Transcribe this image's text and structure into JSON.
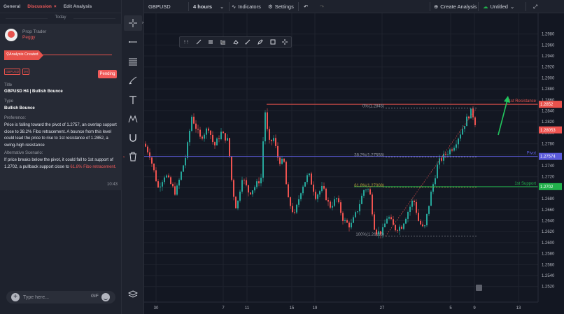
{
  "panel": {
    "tabs": [
      {
        "label": "General"
      },
      {
        "label": "Discussion",
        "close": "×"
      },
      {
        "label": "Edit Analysis"
      }
    ],
    "day_divider": "Today",
    "post": {
      "author_role": "Prop Trader",
      "author_name": "Peggy",
      "status_banner": "Analysis Created",
      "badges": [
        "GBPUSD",
        "0H"
      ],
      "status_button": "Pending",
      "title_label": "Title",
      "title_value": "GBPUSD H4 | Bullish Bounce",
      "type_label": "Type",
      "type_value": "Bullish Bounce",
      "preference_label": "Preference:",
      "preference_text": "Price is falling toward the pivot of 1.2757, an overlap support close to 38.2% Fibo retracement. A bounce from this level could lead the price to rise to 1st resistance of 1.2852, a swing-high resistance",
      "alt_label": "Alternative Scenario:",
      "alt_text_main": "If price breaks below the pivot, it could fall to 1st support of 1.2702, a pullback support close to ",
      "alt_text_highlight": "61.8% Fibo retracement.",
      "time": "10:43"
    },
    "composer": {
      "placeholder": "Type here...",
      "gif_label": "GIF"
    }
  },
  "toolbar": {
    "symbol": "GBPUSD",
    "interval": "4 hours",
    "indicators": "Indicators",
    "settings": "Settings",
    "create_analysis": "Create Analysis",
    "layout_name": "Untitled"
  },
  "vertical_tools": [
    "crosshair-icon",
    "horizontal-line-icon",
    "fib-retracement-icon",
    "brush-icon",
    "text-icon",
    "pattern-icon",
    "magnet-icon",
    "trash-icon"
  ],
  "chart_data": {
    "type": "candlestick",
    "symbol": "GBPUSD",
    "timeframe": "4 hours",
    "ylim": [
      1.2512,
      1.2991
    ],
    "y_ticks": [
      "1.2980",
      "1.2960",
      "1.2940",
      "1.2920",
      "1.2900",
      "1.2880",
      "1.2860",
      "1.2840",
      "1.2820",
      "1.2800",
      "1.2780",
      "1.2760",
      "1.2740",
      "1.2720",
      "1.2700",
      "1.2680",
      "1.2660",
      "1.2640",
      "1.2620",
      "1.2600",
      "1.2580",
      "1.2560",
      "1.2540",
      "1.2520"
    ],
    "x_ticks": [
      "30",
      "7",
      "11",
      "15",
      "19",
      "27",
      "5",
      "9",
      "13"
    ],
    "levels": [
      {
        "name": "1st Resistance",
        "price": 1.2852,
        "price_label": "1.2852",
        "color": "#e8524c"
      },
      {
        "name": "Pivot",
        "price": 1.2757,
        "price_label": "1.27574",
        "color": "#5b5bdb"
      },
      {
        "name": "1st Support",
        "price": 1.2702,
        "price_label": "1.2702",
        "color": "#22b14c"
      }
    ],
    "fib": [
      {
        "label": "0%(1.2845)",
        "price": 1.2845,
        "color": "#9598a1"
      },
      {
        "label": "38.2%(1.27558)",
        "price": 1.27558,
        "color": "#9598a1"
      },
      {
        "label": "61.8%(1.27008)",
        "price": 1.27008,
        "color": "#b8a43a"
      },
      {
        "label": "100%(1.26116)",
        "price": 1.26116,
        "color": "#9598a1"
      }
    ],
    "last_price": "1.28053",
    "colors": {
      "up": "#26a69a",
      "down": "#ef5350",
      "grid": "#1f232e",
      "background": "#131722"
    }
  }
}
